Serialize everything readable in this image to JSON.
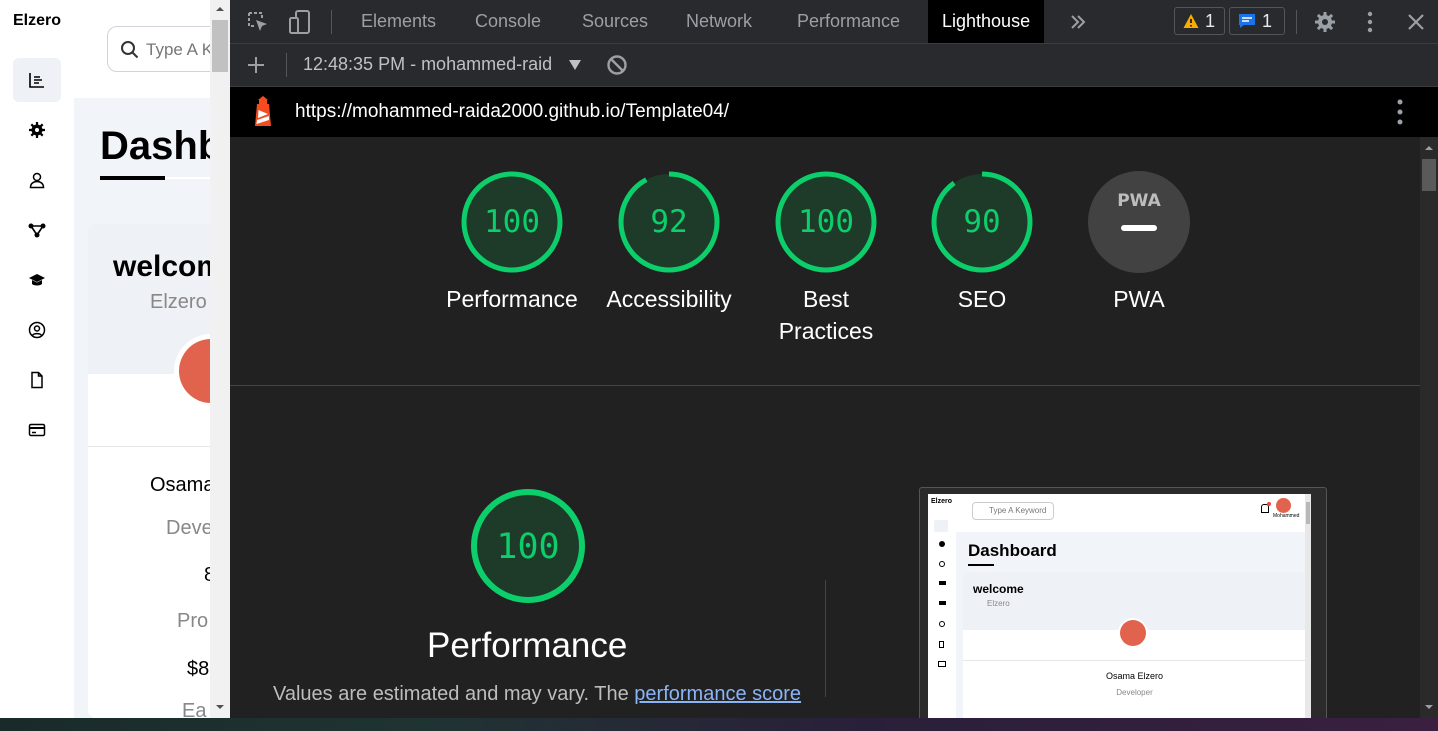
{
  "site": {
    "brand": "Elzero",
    "search_placeholder": "Type A Keyword",
    "page_title": "Dashboard",
    "welcome": "welcome",
    "welcome_sub": "Elzero",
    "name": "Osama Elzero",
    "role": "Developer",
    "stat1": "8",
    "stat2": "Pro",
    "stat3": "$8",
    "stat4": "Ea"
  },
  "devtools": {
    "tabs": [
      "Elements",
      "Console",
      "Sources",
      "Network",
      "Performance",
      "Lighthouse"
    ],
    "active_tab": "Lighthouse",
    "warnings_count": "1",
    "messages_count": "1",
    "session": "12:48:35 PM - mohammed-raid",
    "url": "https://mohammed-raida2000.github.io/Template04/"
  },
  "report": {
    "gauges": [
      {
        "label": "Performance",
        "score": "100",
        "fraction": 1.0
      },
      {
        "label": "Accessibility",
        "score": "92",
        "fraction": 0.92
      },
      {
        "label": "Best Practices",
        "score": "100",
        "fraction": 1.0
      },
      {
        "label": "SEO",
        "score": "90",
        "fraction": 0.9
      }
    ],
    "pwa": {
      "label": "PWA",
      "badge": "PWA"
    },
    "main_score": "100",
    "main_label": "Performance",
    "note_text": "Values are estimated and may vary. The ",
    "note_link": "performance score",
    "colors": {
      "pass": "#0cce6b",
      "pass_bg": "#1e3a29"
    }
  },
  "screenshot": {
    "brand": "Elzero",
    "search": "Type A Keyword",
    "title": "Dashboard",
    "welcome": "welcome",
    "welcome_sub": "Elzero",
    "name": "Osama Elzero",
    "role": "Developer",
    "user": "Mohammed"
  }
}
